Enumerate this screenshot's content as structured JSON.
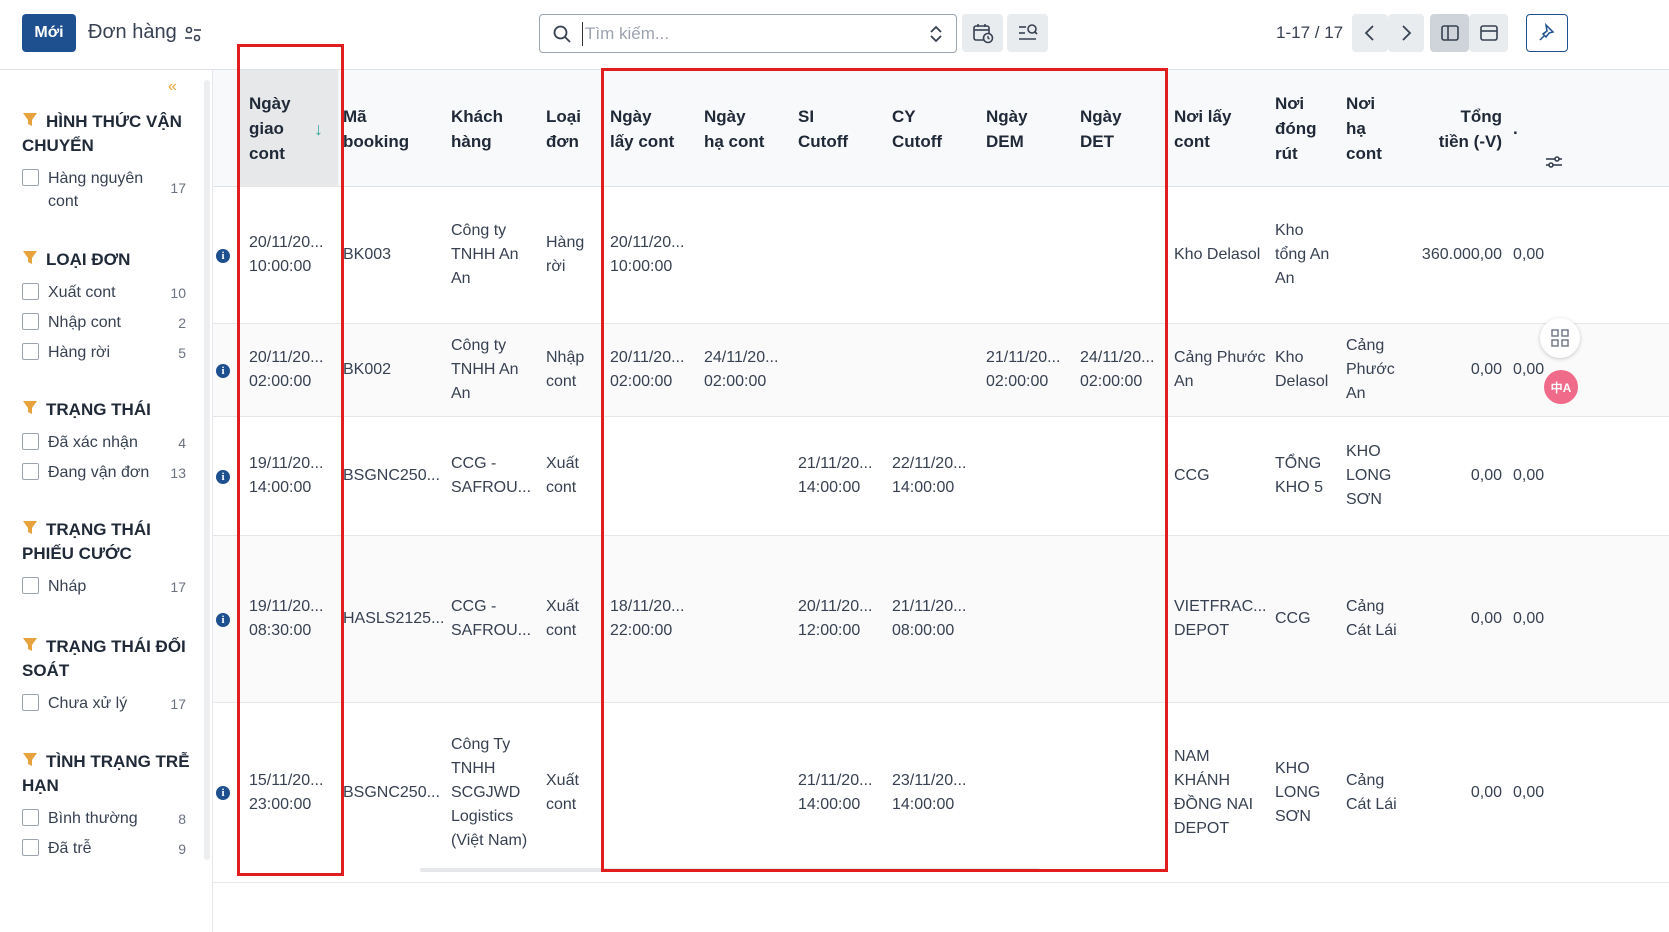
{
  "toolbar": {
    "new_label": "Mới",
    "title": "Đơn hàng",
    "search_placeholder": "Tìm kiếm...",
    "pager": "1-17 / 17"
  },
  "sidebar": {
    "groups": [
      {
        "title_lines": [
          "HÌNH THỨC VẬN",
          "CHUYỂN"
        ],
        "items": [
          {
            "label": "Hàng nguyên cont",
            "count": "17"
          }
        ]
      },
      {
        "title_lines": [
          "LOẠI ĐƠN"
        ],
        "items": [
          {
            "label": "Xuất cont",
            "count": "10"
          },
          {
            "label": "Nhập cont",
            "count": "2"
          },
          {
            "label": "Hàng rời",
            "count": "5"
          }
        ]
      },
      {
        "title_lines": [
          "TRẠNG THÁI"
        ],
        "items": [
          {
            "label": "Đã xác nhận",
            "count": "4"
          },
          {
            "label": "Đang vận đơn",
            "count": "13"
          }
        ]
      },
      {
        "title_lines": [
          "TRẠNG THÁI",
          "PHIẾU CƯỚC"
        ],
        "items": [
          {
            "label": "Nháp",
            "count": "17"
          }
        ]
      },
      {
        "title_lines": [
          "TRẠNG THÁI ĐỐI",
          "SOÁT"
        ],
        "items": [
          {
            "label": "Chưa xử lý",
            "count": "17"
          }
        ]
      },
      {
        "title_lines": [
          "TÌNH TRẠNG TRỄ",
          "HẠN"
        ],
        "items": [
          {
            "label": "Bình thường",
            "count": "8"
          },
          {
            "label": "Đã trễ",
            "count": "9"
          }
        ]
      }
    ]
  },
  "table": {
    "columns": [
      "Ngày\ngiao\ncont",
      "Mã\nbooking",
      "Khách\nhàng",
      "Loại\nđơn",
      "Ngày\nlấy cont",
      "Ngày\nhạ cont",
      "SI\nCutoff",
      "CY\nCutoff",
      "Ngày\nDEM",
      "Ngày\nDET",
      "Nơi lấy\ncont",
      "Nơi\nđóng\nrút",
      "Nơi\nhạ\ncont",
      "Tổng\ntiền (-V)",
      "."
    ],
    "rows": [
      [
        "20/11/20...\n10:00:00",
        "BK003",
        "Công ty\nTNHH An\nAn",
        "Hàng\nrời",
        "20/11/20...\n10:00:00",
        "",
        "",
        "",
        "",
        "",
        "Kho Delasol",
        "Kho\ntổng An\nAn",
        "",
        "360.000,00",
        "0,00"
      ],
      [
        "20/11/20...\n02:00:00",
        "BK002",
        "Công ty\nTNHH An\nAn",
        "Nhập\ncont",
        "20/11/20...\n02:00:00",
        "24/11/20...\n02:00:00",
        "",
        "",
        "21/11/20...\n02:00:00",
        "24/11/20...\n02:00:00",
        "Cảng Phước\nAn",
        "Kho\nDelasol",
        "Cảng\nPhước\nAn",
        "0,00",
        "0,00"
      ],
      [
        "19/11/20...\n14:00:00",
        "BSGNC250...",
        "CCG -\nSAFROU...",
        "Xuất\ncont",
        "",
        "",
        "21/11/20...\n14:00:00",
        "22/11/20...\n14:00:00",
        "",
        "",
        "CCG",
        "TỔNG\nKHO 5",
        "KHO\nLONG\nSƠN",
        "0,00",
        "0,00"
      ],
      [
        "19/11/20...\n08:30:00",
        "HASLS2125...",
        "CCG -\nSAFROU...",
        "Xuất\ncont",
        "18/11/20...\n22:00:00",
        "",
        "20/11/20...\n12:00:00",
        "21/11/20...\n08:00:00",
        "",
        "",
        "VIETFRAC...\nDEPOT",
        "CCG",
        "Cảng\nCát Lái",
        "0,00",
        "0,00"
      ],
      [
        "15/11/20...\n23:00:00",
        "BSGNC250...",
        "Công Ty\nTNHH\nSCGJWD\nLogistics\n(Việt Nam)",
        "Xuất\ncont",
        "",
        "",
        "21/11/20...\n14:00:00",
        "23/11/20...\n14:00:00",
        "",
        "",
        "NAM\nKHÁNH\nĐỒNG NAI\nDEPOT",
        "KHO\nLONG\nSƠN",
        "Cảng\nCát Lái",
        "0,00",
        "0,00"
      ]
    ]
  },
  "floating": {
    "translate_badge": "中A"
  },
  "colors": {
    "primary": "#1e4f8f",
    "filter_icon": "#e6a23c",
    "annotation": "#e11d1d",
    "sort": "#3aa8a0"
  }
}
